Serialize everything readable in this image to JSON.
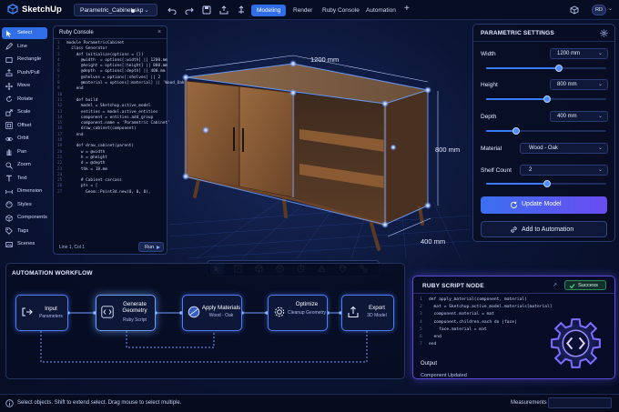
{
  "app": {
    "name": "SketchUp",
    "file_tab": "Parametric_Cabinet.skp"
  },
  "nav_tabs": [
    {
      "label": "Modeling",
      "active": true
    },
    {
      "label": "Render",
      "active": false
    },
    {
      "label": "Ruby Console",
      "active": false
    },
    {
      "label": "Automation",
      "active": false
    }
  ],
  "user": {
    "initials": "RD"
  },
  "tools": [
    {
      "label": "Select",
      "icon": "cursor-icon",
      "active": true
    },
    {
      "label": "Line",
      "icon": "pencil-icon"
    },
    {
      "label": "Rectangle",
      "icon": "rectangle-icon"
    },
    {
      "label": "Push/Pull",
      "icon": "push-pull-icon"
    },
    {
      "label": "Move",
      "icon": "move-icon"
    },
    {
      "label": "Rotate",
      "icon": "rotate-icon"
    },
    {
      "label": "Scale",
      "icon": "scale-icon"
    },
    {
      "label": "Offset",
      "icon": "offset-icon"
    },
    {
      "label": "Orbit",
      "icon": "orbit-icon"
    },
    {
      "label": "Pan",
      "icon": "hand-icon"
    },
    {
      "label": "Zoom",
      "icon": "zoom-icon"
    },
    {
      "label": "Text",
      "icon": "text-icon"
    },
    {
      "label": "Dimension",
      "icon": "dimension-icon"
    },
    {
      "label": "Styles",
      "icon": "styles-icon"
    },
    {
      "label": "Components",
      "icon": "components-icon"
    },
    {
      "label": "Tags",
      "icon": "tag-icon"
    },
    {
      "label": "Scenes",
      "icon": "scenes-icon"
    }
  ],
  "console": {
    "title": "Ruby Console",
    "lines": [
      {
        "n": "1",
        "t": "module ParametricCabinet"
      },
      {
        "n": "2",
        "t": "  class Generator"
      },
      {
        "n": "3",
        "t": "    def initialize(options = {})"
      },
      {
        "n": "4",
        "t": "      @width  = options[:width] || 1200.mm"
      },
      {
        "n": "5",
        "t": "      @height = options[:height] || 800.mm"
      },
      {
        "n": "6",
        "t": "      @depth  = options[:depth] || 400.mm"
      },
      {
        "n": "7",
        "t": "      @shelves = options[:shelves] || 2"
      },
      {
        "n": "8",
        "t": "      @material = options[:material] || 'Wood_Oak'"
      },
      {
        "n": "9",
        "t": "    end"
      },
      {
        "n": "10",
        "t": ""
      },
      {
        "n": "11",
        "t": "    def build"
      },
      {
        "n": "12",
        "t": "      model = Sketchup.active_model"
      },
      {
        "n": "13",
        "t": "      entities = model.active_entities"
      },
      {
        "n": "14",
        "t": "      component = entities.add_group"
      },
      {
        "n": "15",
        "t": "      component.name = 'Parametric Cabinet'"
      },
      {
        "n": "16",
        "t": "      draw_cabinet(component)"
      },
      {
        "n": "17",
        "t": "    end"
      },
      {
        "n": "18",
        "t": ""
      },
      {
        "n": "19",
        "t": "    def draw_cabinet(parent)"
      },
      {
        "n": "20",
        "t": "      w = @width"
      },
      {
        "n": "21",
        "t": "      h = @height"
      },
      {
        "n": "22",
        "t": "      d = @depth"
      },
      {
        "n": "23",
        "t": "      thk = 18.mm"
      },
      {
        "n": "24",
        "t": ""
      },
      {
        "n": "25",
        "t": "      # Cabinet carcass"
      },
      {
        "n": "26",
        "t": "      pts = ["
      },
      {
        "n": "27",
        "t": "        Geom::Point3d.new(0, 0, 0),"
      }
    ],
    "status": "Line 1, Col 1",
    "run_label": "Run"
  },
  "model": {
    "dim_width": "1200 mm",
    "dim_height": "800 mm",
    "dim_depth": "400 mm",
    "colors": {
      "wood": "#8a5a33",
      "wood_dark": "#5a3a22",
      "glow": "#4d8dff"
    }
  },
  "params": {
    "title": "PARAMETRIC SETTINGS",
    "width": {
      "label": "Width",
      "value": "1200 mm",
      "slider": 0.6
    },
    "height": {
      "label": "Height",
      "value": "800 mm",
      "slider": 0.5
    },
    "depth": {
      "label": "Depth",
      "value": "400 mm",
      "slider": 0.25
    },
    "material": {
      "label": "Material",
      "value": "Wood - Oak"
    },
    "shelf_count": {
      "label": "Shelf Count",
      "value": "2",
      "slider": 0.5
    },
    "update_label": "Update Model",
    "add_label": "Add to Automation"
  },
  "viewbar": [
    "select-view-icon",
    "frame-icon",
    "box-icon",
    "globe-icon",
    "camera-icon",
    "section-icon",
    "shield-icon",
    "link-icon"
  ],
  "workflow": {
    "title": "AUTOMATION WORKFLOW",
    "nodes": [
      {
        "title": "Input",
        "sub": "Parameters",
        "icon": "input-icon"
      },
      {
        "title": "Generate Geometry",
        "sub": "Ruby Script",
        "icon": "code-icon"
      },
      {
        "title": "Apply Materials",
        "sub": "Wood - Oak",
        "icon": "sphere-icon"
      },
      {
        "title": "Optimize",
        "sub": "Cleanup Geometry",
        "icon": "gear-icon"
      },
      {
        "title": "Export",
        "sub": "3D Model",
        "icon": "export-icon"
      }
    ]
  },
  "script_node": {
    "title": "RUBY SCRIPT NODE",
    "status": "Success",
    "lines": [
      {
        "n": "1",
        "t": "def apply_material(component, material)"
      },
      {
        "n": "2",
        "t": "  mat = Sketchup.active_model.materials[material]"
      },
      {
        "n": "3",
        "t": "  component.material = mat"
      },
      {
        "n": "4",
        "t": "  component.children.each do |face|"
      },
      {
        "n": "5",
        "t": "    face.material = mat"
      },
      {
        "n": "6",
        "t": "  end"
      },
      {
        "n": "7",
        "t": "end"
      }
    ],
    "output_label": "Output",
    "output_value": "Component Updated"
  },
  "statusbar": {
    "text": "Select objects. Shift to extend select. Drag mouse to select multiple.",
    "measurements_label": "Measurements"
  }
}
